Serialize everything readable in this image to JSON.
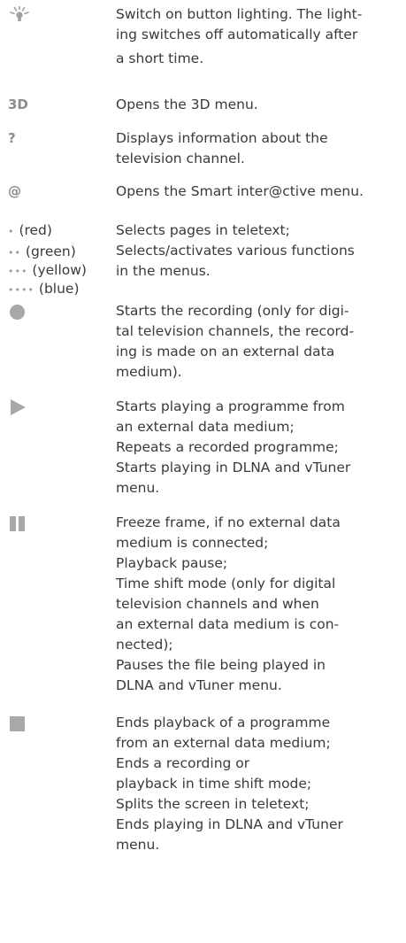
{
  "entries": [
    {
      "key_icon": "light-bulb-icon",
      "lines": [
        "Switch on button lighting. The light-",
        "ing switches off automatically after",
        "a short time."
      ]
    },
    {
      "key_label": "3D",
      "lines": [
        "Opens the 3D menu."
      ]
    },
    {
      "key_label": "?",
      "lines": [
        "Displays information about the",
        "television channel."
      ]
    },
    {
      "key_label": "@",
      "lines": [
        "Opens the Smart inter@ctive menu."
      ]
    },
    {
      "key_colors": [
        "(red)",
        "(green)",
        "(yellow)",
        "(blue)"
      ],
      "lines": [
        "Selects pages in teletext;",
        "Selects/activates various functions",
        "in the menus."
      ]
    },
    {
      "key_icon": "record-icon",
      "lines": [
        "Starts the recording (only for digi-",
        "tal television channels, the record-",
        "ing is made on an external data",
        "medium)."
      ]
    },
    {
      "key_icon": "play-icon",
      "lines": [
        "Starts playing a programme from",
        "an external data medium;",
        "Repeats a recorded programme;",
        "Starts playing in DLNA and vTuner",
        "menu."
      ]
    },
    {
      "key_icon": "pause-icon",
      "lines": [
        "Freeze frame, if no external data",
        "medium is connected;",
        "Playback pause;",
        "Time shift mode (only for digital",
        "television channels and when",
        "an external data medium is con-",
        "nected);",
        "Pauses the file being played in",
        "DLNA and vTuner menu."
      ]
    },
    {
      "key_icon": "stop-icon",
      "lines": [
        "Ends playback of a programme",
        "from an external data medium;",
        "Ends a recording or",
        "playback in time shift mode;",
        "Splits the screen in teletext;",
        "Ends playing in DLNA and vTuner",
        "menu."
      ]
    }
  ]
}
